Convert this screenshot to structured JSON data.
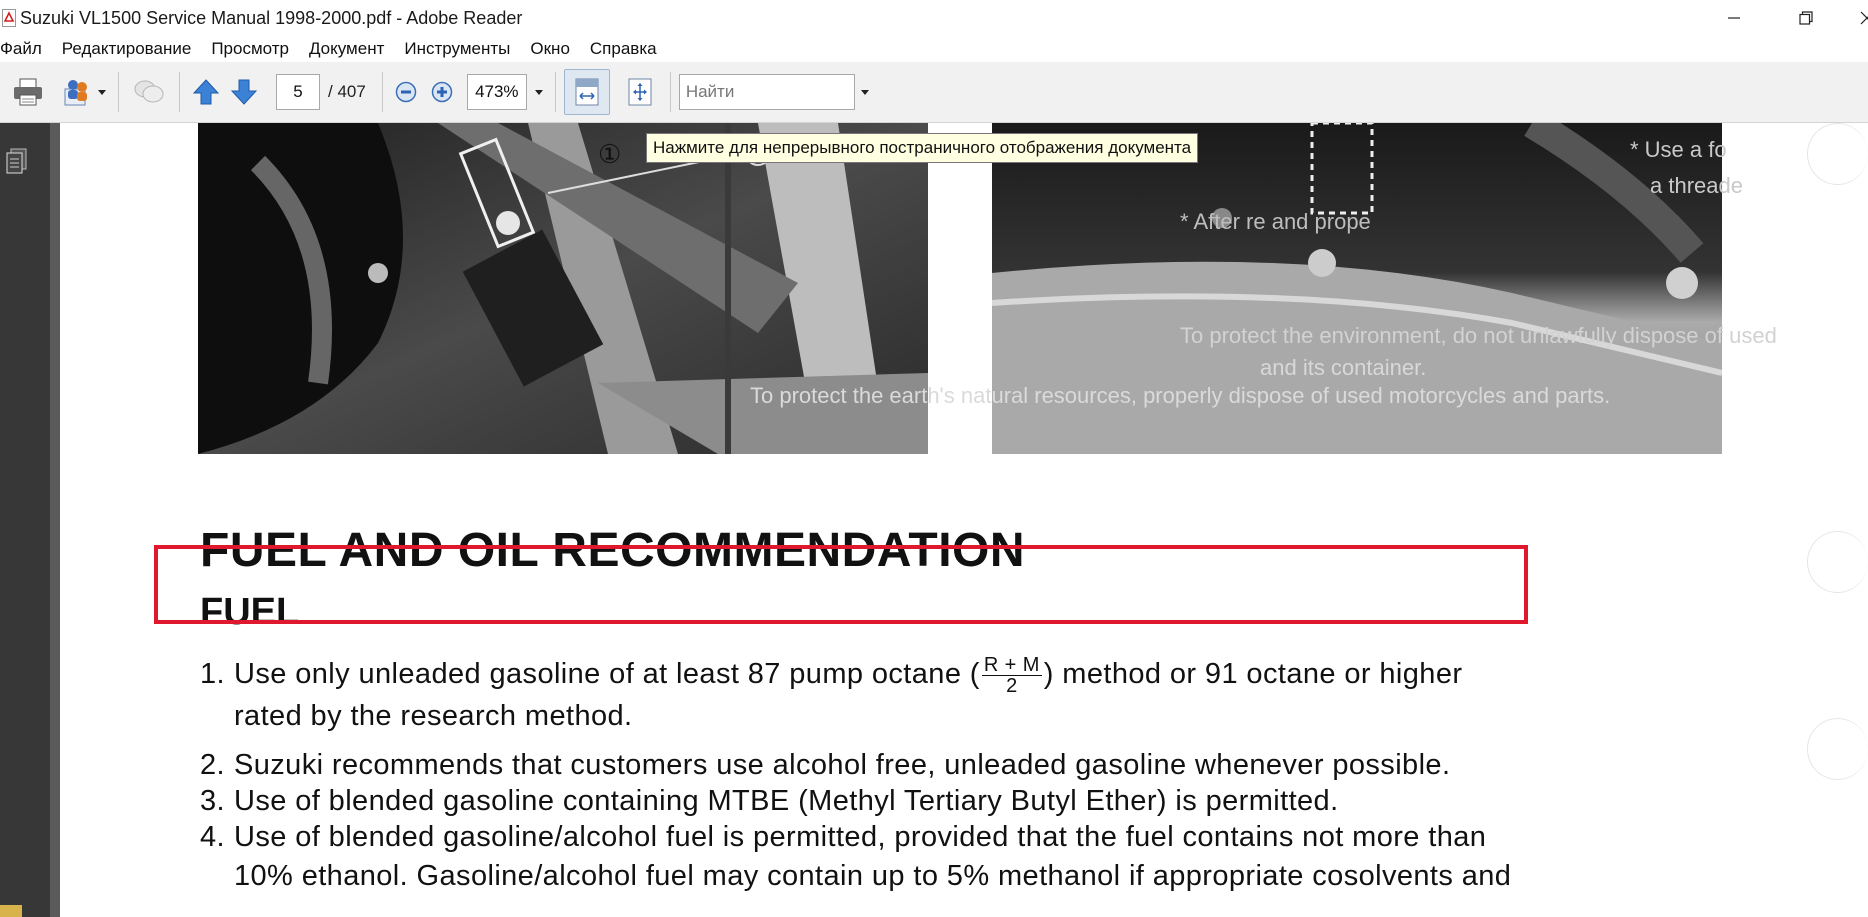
{
  "window": {
    "title": "Suzuki VL1500 Service Manual 1998-2000.pdf - Adobe Reader"
  },
  "menu": {
    "items": [
      "Файл",
      "Редактирование",
      "Просмотр",
      "Документ",
      "Инструменты",
      "Окно",
      "Справка"
    ]
  },
  "toolbar": {
    "current_page": "5",
    "total_pages": "/ 407",
    "zoom": "473%",
    "find_placeholder": "Найти"
  },
  "tooltip": {
    "text": "Нажмите для непрерывного постраничного отображения документа"
  },
  "document": {
    "figure_callout": "①",
    "ghost_lines": [
      "* Use a fo",
      "a threade",
      "* After re                                          and prope",
      "To protect the environment, do not unlawfully dispose of used",
      "and its container.",
      "To protect the earth's natural resources, properly dispose of used motorcycles and parts."
    ],
    "heading": "FUEL AND OIL RECOMMENDATION",
    "subheading": "FUEL",
    "items": [
      {
        "num": "1.",
        "pre": "Use only unleaded gasoline of at least 87 pump octane (",
        "frac_top": "R + M",
        "frac_bottom": "2",
        "post": ") method or 91 octane or higher",
        "line2": "rated by the research method."
      },
      {
        "num": "2.",
        "text": "Suzuki recommends that customers use alcohol free, unleaded gasoline whenever possible."
      },
      {
        "num": "3.",
        "text": "Use of blended gasoline containing MTBE (Methyl Tertiary Butyl Ether) is permitted."
      },
      {
        "num": "4.",
        "text": "Use of blended gasoline/alcohol fuel is permitted, provided that the fuel contains not more than",
        "line2": "10% ethanol. Gasoline/alcohol fuel may contain up to 5% methanol if appropriate cosolvents and"
      }
    ]
  },
  "colors": {
    "highlight_border": "#e0182d",
    "tooltip_bg": "#ffffe1",
    "nav_bg": "#373737"
  }
}
